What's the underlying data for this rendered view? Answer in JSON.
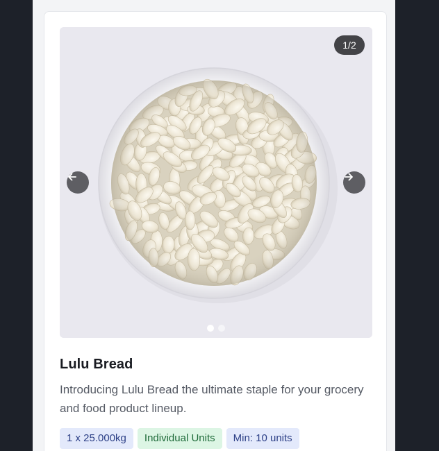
{
  "product": {
    "name": "Lulu Bread",
    "description": "Introducing Lulu Bread the ultimate staple for your grocery and food product lineup.",
    "tags": {
      "package": "1 x 25.000kg",
      "unit_type": "Individual Units",
      "minimum": "Min: 10 units"
    }
  },
  "carousel": {
    "counter": "1/2",
    "current_slide": 1,
    "total_slides": 2,
    "prev_icon": "arrow-left-icon",
    "next_icon": "arrow-right-icon"
  },
  "colors": {
    "background": "#1d2129",
    "tag_blue": "#e3e9fb",
    "tag_green": "#dcf5e4"
  }
}
